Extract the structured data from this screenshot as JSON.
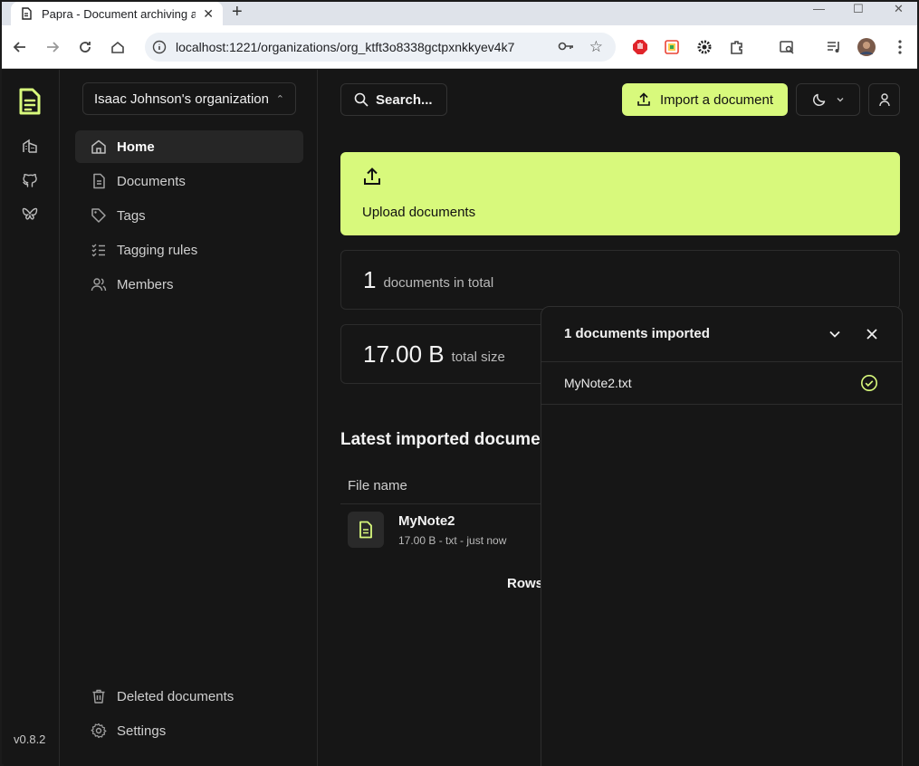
{
  "browser": {
    "tab_title": "Papra - Document archiving and",
    "url": "localhost:1221/organizations/org_ktft3o8338gctpxnkkyev4k7"
  },
  "rail": {
    "version": "v0.8.2"
  },
  "sidebar": {
    "org_name": "Isaac Johnson's organization",
    "items": [
      {
        "label": "Home",
        "icon": "home-icon",
        "active": true
      },
      {
        "label": "Documents",
        "icon": "document-icon"
      },
      {
        "label": "Tags",
        "icon": "tag-icon"
      },
      {
        "label": "Tagging rules",
        "icon": "list-check-icon"
      },
      {
        "label": "Members",
        "icon": "users-icon"
      }
    ],
    "bottom_items": [
      {
        "label": "Deleted documents",
        "icon": "trash-icon"
      },
      {
        "label": "Settings",
        "icon": "gear-icon"
      }
    ]
  },
  "header": {
    "search_label": "Search...",
    "import_label": "Import a document"
  },
  "upload": {
    "label": "Upload documents"
  },
  "stats": {
    "docs_count": "1",
    "docs_caption": "documents in total",
    "size_value": "17.00 B",
    "size_caption": "total size"
  },
  "latest": {
    "title": "Latest imported documents",
    "column_file_name": "File name",
    "rows": [
      {
        "name": "MyNote2",
        "meta": "17.00 B - txt - just now"
      }
    ],
    "rows_label": "Rows"
  },
  "import_panel": {
    "title": "1 documents imported",
    "files": [
      {
        "name": "MyNote2.txt",
        "status": "done"
      }
    ]
  },
  "colors": {
    "accent": "#d8f97c",
    "background": "#161616"
  }
}
